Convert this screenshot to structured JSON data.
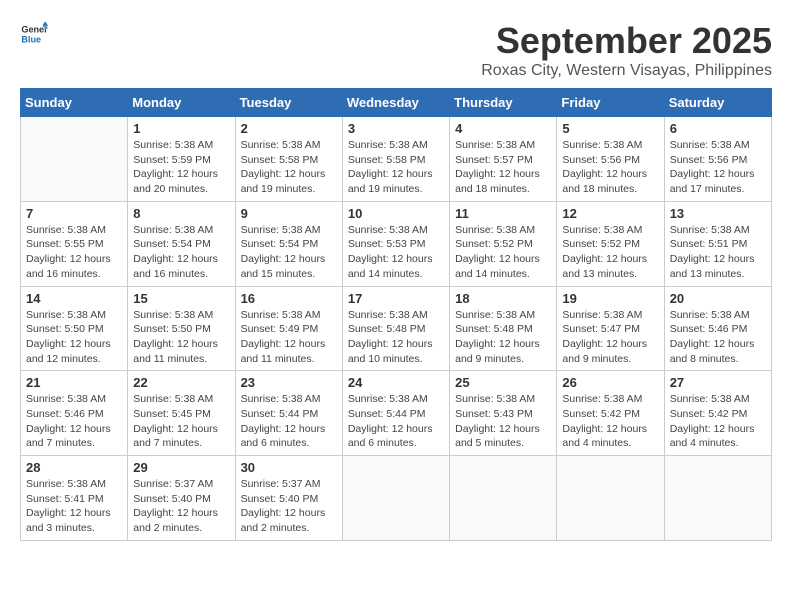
{
  "logo": {
    "general": "General",
    "blue": "Blue"
  },
  "title": "September 2025",
  "location": "Roxas City, Western Visayas, Philippines",
  "days_of_week": [
    "Sunday",
    "Monday",
    "Tuesday",
    "Wednesday",
    "Thursday",
    "Friday",
    "Saturday"
  ],
  "weeks": [
    [
      {
        "day": "",
        "info": ""
      },
      {
        "day": "1",
        "info": "Sunrise: 5:38 AM\nSunset: 5:59 PM\nDaylight: 12 hours\nand 20 minutes."
      },
      {
        "day": "2",
        "info": "Sunrise: 5:38 AM\nSunset: 5:58 PM\nDaylight: 12 hours\nand 19 minutes."
      },
      {
        "day": "3",
        "info": "Sunrise: 5:38 AM\nSunset: 5:58 PM\nDaylight: 12 hours\nand 19 minutes."
      },
      {
        "day": "4",
        "info": "Sunrise: 5:38 AM\nSunset: 5:57 PM\nDaylight: 12 hours\nand 18 minutes."
      },
      {
        "day": "5",
        "info": "Sunrise: 5:38 AM\nSunset: 5:56 PM\nDaylight: 12 hours\nand 18 minutes."
      },
      {
        "day": "6",
        "info": "Sunrise: 5:38 AM\nSunset: 5:56 PM\nDaylight: 12 hours\nand 17 minutes."
      }
    ],
    [
      {
        "day": "7",
        "info": "Sunrise: 5:38 AM\nSunset: 5:55 PM\nDaylight: 12 hours\nand 16 minutes."
      },
      {
        "day": "8",
        "info": "Sunrise: 5:38 AM\nSunset: 5:54 PM\nDaylight: 12 hours\nand 16 minutes."
      },
      {
        "day": "9",
        "info": "Sunrise: 5:38 AM\nSunset: 5:54 PM\nDaylight: 12 hours\nand 15 minutes."
      },
      {
        "day": "10",
        "info": "Sunrise: 5:38 AM\nSunset: 5:53 PM\nDaylight: 12 hours\nand 14 minutes."
      },
      {
        "day": "11",
        "info": "Sunrise: 5:38 AM\nSunset: 5:52 PM\nDaylight: 12 hours\nand 14 minutes."
      },
      {
        "day": "12",
        "info": "Sunrise: 5:38 AM\nSunset: 5:52 PM\nDaylight: 12 hours\nand 13 minutes."
      },
      {
        "day": "13",
        "info": "Sunrise: 5:38 AM\nSunset: 5:51 PM\nDaylight: 12 hours\nand 13 minutes."
      }
    ],
    [
      {
        "day": "14",
        "info": "Sunrise: 5:38 AM\nSunset: 5:50 PM\nDaylight: 12 hours\nand 12 minutes."
      },
      {
        "day": "15",
        "info": "Sunrise: 5:38 AM\nSunset: 5:50 PM\nDaylight: 12 hours\nand 11 minutes."
      },
      {
        "day": "16",
        "info": "Sunrise: 5:38 AM\nSunset: 5:49 PM\nDaylight: 12 hours\nand 11 minutes."
      },
      {
        "day": "17",
        "info": "Sunrise: 5:38 AM\nSunset: 5:48 PM\nDaylight: 12 hours\nand 10 minutes."
      },
      {
        "day": "18",
        "info": "Sunrise: 5:38 AM\nSunset: 5:48 PM\nDaylight: 12 hours\nand 9 minutes."
      },
      {
        "day": "19",
        "info": "Sunrise: 5:38 AM\nSunset: 5:47 PM\nDaylight: 12 hours\nand 9 minutes."
      },
      {
        "day": "20",
        "info": "Sunrise: 5:38 AM\nSunset: 5:46 PM\nDaylight: 12 hours\nand 8 minutes."
      }
    ],
    [
      {
        "day": "21",
        "info": "Sunrise: 5:38 AM\nSunset: 5:46 PM\nDaylight: 12 hours\nand 7 minutes."
      },
      {
        "day": "22",
        "info": "Sunrise: 5:38 AM\nSunset: 5:45 PM\nDaylight: 12 hours\nand 7 minutes."
      },
      {
        "day": "23",
        "info": "Sunrise: 5:38 AM\nSunset: 5:44 PM\nDaylight: 12 hours\nand 6 minutes."
      },
      {
        "day": "24",
        "info": "Sunrise: 5:38 AM\nSunset: 5:44 PM\nDaylight: 12 hours\nand 6 minutes."
      },
      {
        "day": "25",
        "info": "Sunrise: 5:38 AM\nSunset: 5:43 PM\nDaylight: 12 hours\nand 5 minutes."
      },
      {
        "day": "26",
        "info": "Sunrise: 5:38 AM\nSunset: 5:42 PM\nDaylight: 12 hours\nand 4 minutes."
      },
      {
        "day": "27",
        "info": "Sunrise: 5:38 AM\nSunset: 5:42 PM\nDaylight: 12 hours\nand 4 minutes."
      }
    ],
    [
      {
        "day": "28",
        "info": "Sunrise: 5:38 AM\nSunset: 5:41 PM\nDaylight: 12 hours\nand 3 minutes."
      },
      {
        "day": "29",
        "info": "Sunrise: 5:37 AM\nSunset: 5:40 PM\nDaylight: 12 hours\nand 2 minutes."
      },
      {
        "day": "30",
        "info": "Sunrise: 5:37 AM\nSunset: 5:40 PM\nDaylight: 12 hours\nand 2 minutes."
      },
      {
        "day": "",
        "info": ""
      },
      {
        "day": "",
        "info": ""
      },
      {
        "day": "",
        "info": ""
      },
      {
        "day": "",
        "info": ""
      }
    ]
  ]
}
